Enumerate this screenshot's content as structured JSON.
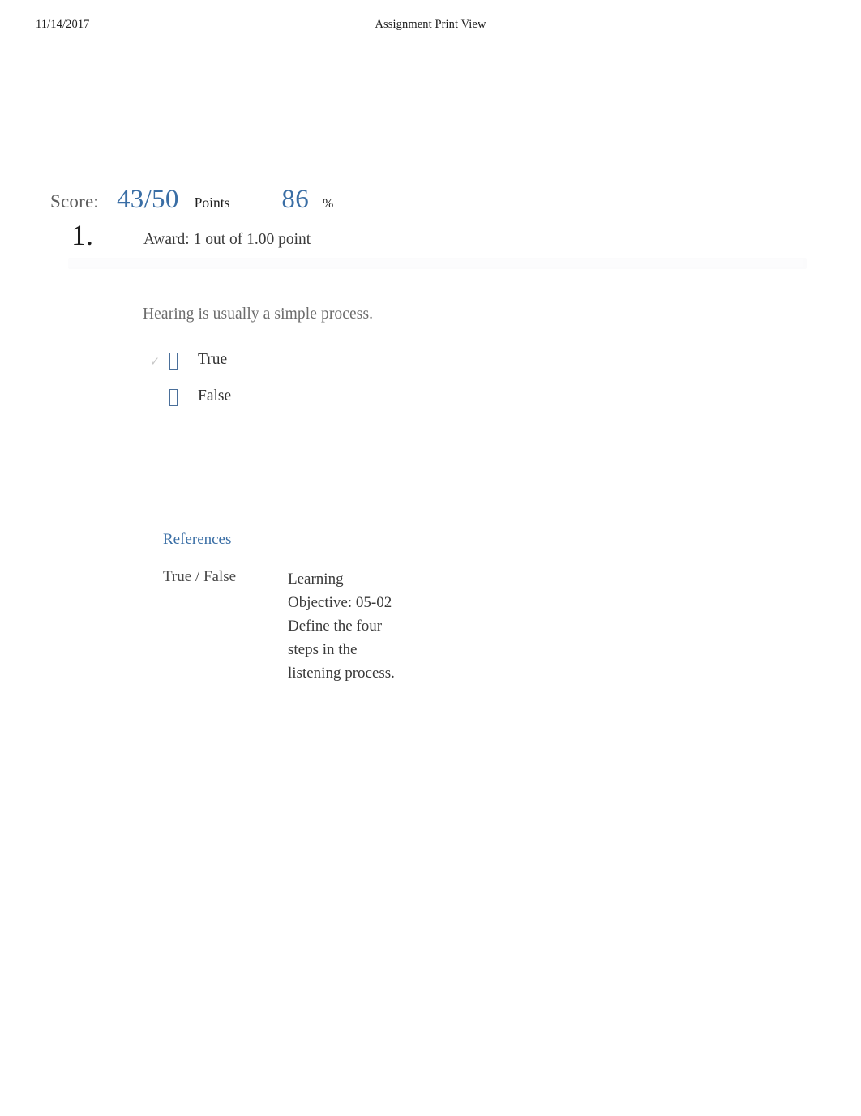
{
  "header": {
    "date": "11/14/2017",
    "title": "Assignment Print View"
  },
  "score": {
    "label": "Score:",
    "points_value": "43/50",
    "points_unit": "Points",
    "percent_value": "86",
    "percent_unit": "%",
    "accent_color": "#3a6ea5"
  },
  "question": {
    "number": "1.",
    "award": "Award: 1 out of 1.00 point",
    "stem": "Hearing is usually a simple process.",
    "options": [
      {
        "label": "True",
        "selected_mark": "✓",
        "is_selected": true
      },
      {
        "label": "False",
        "selected_mark": "",
        "is_selected": false
      }
    ]
  },
  "references": {
    "link_label": "References",
    "question_type": "True / False",
    "learning_objective": "Learning Objective: 05-02 Define the four steps in the listening process."
  }
}
